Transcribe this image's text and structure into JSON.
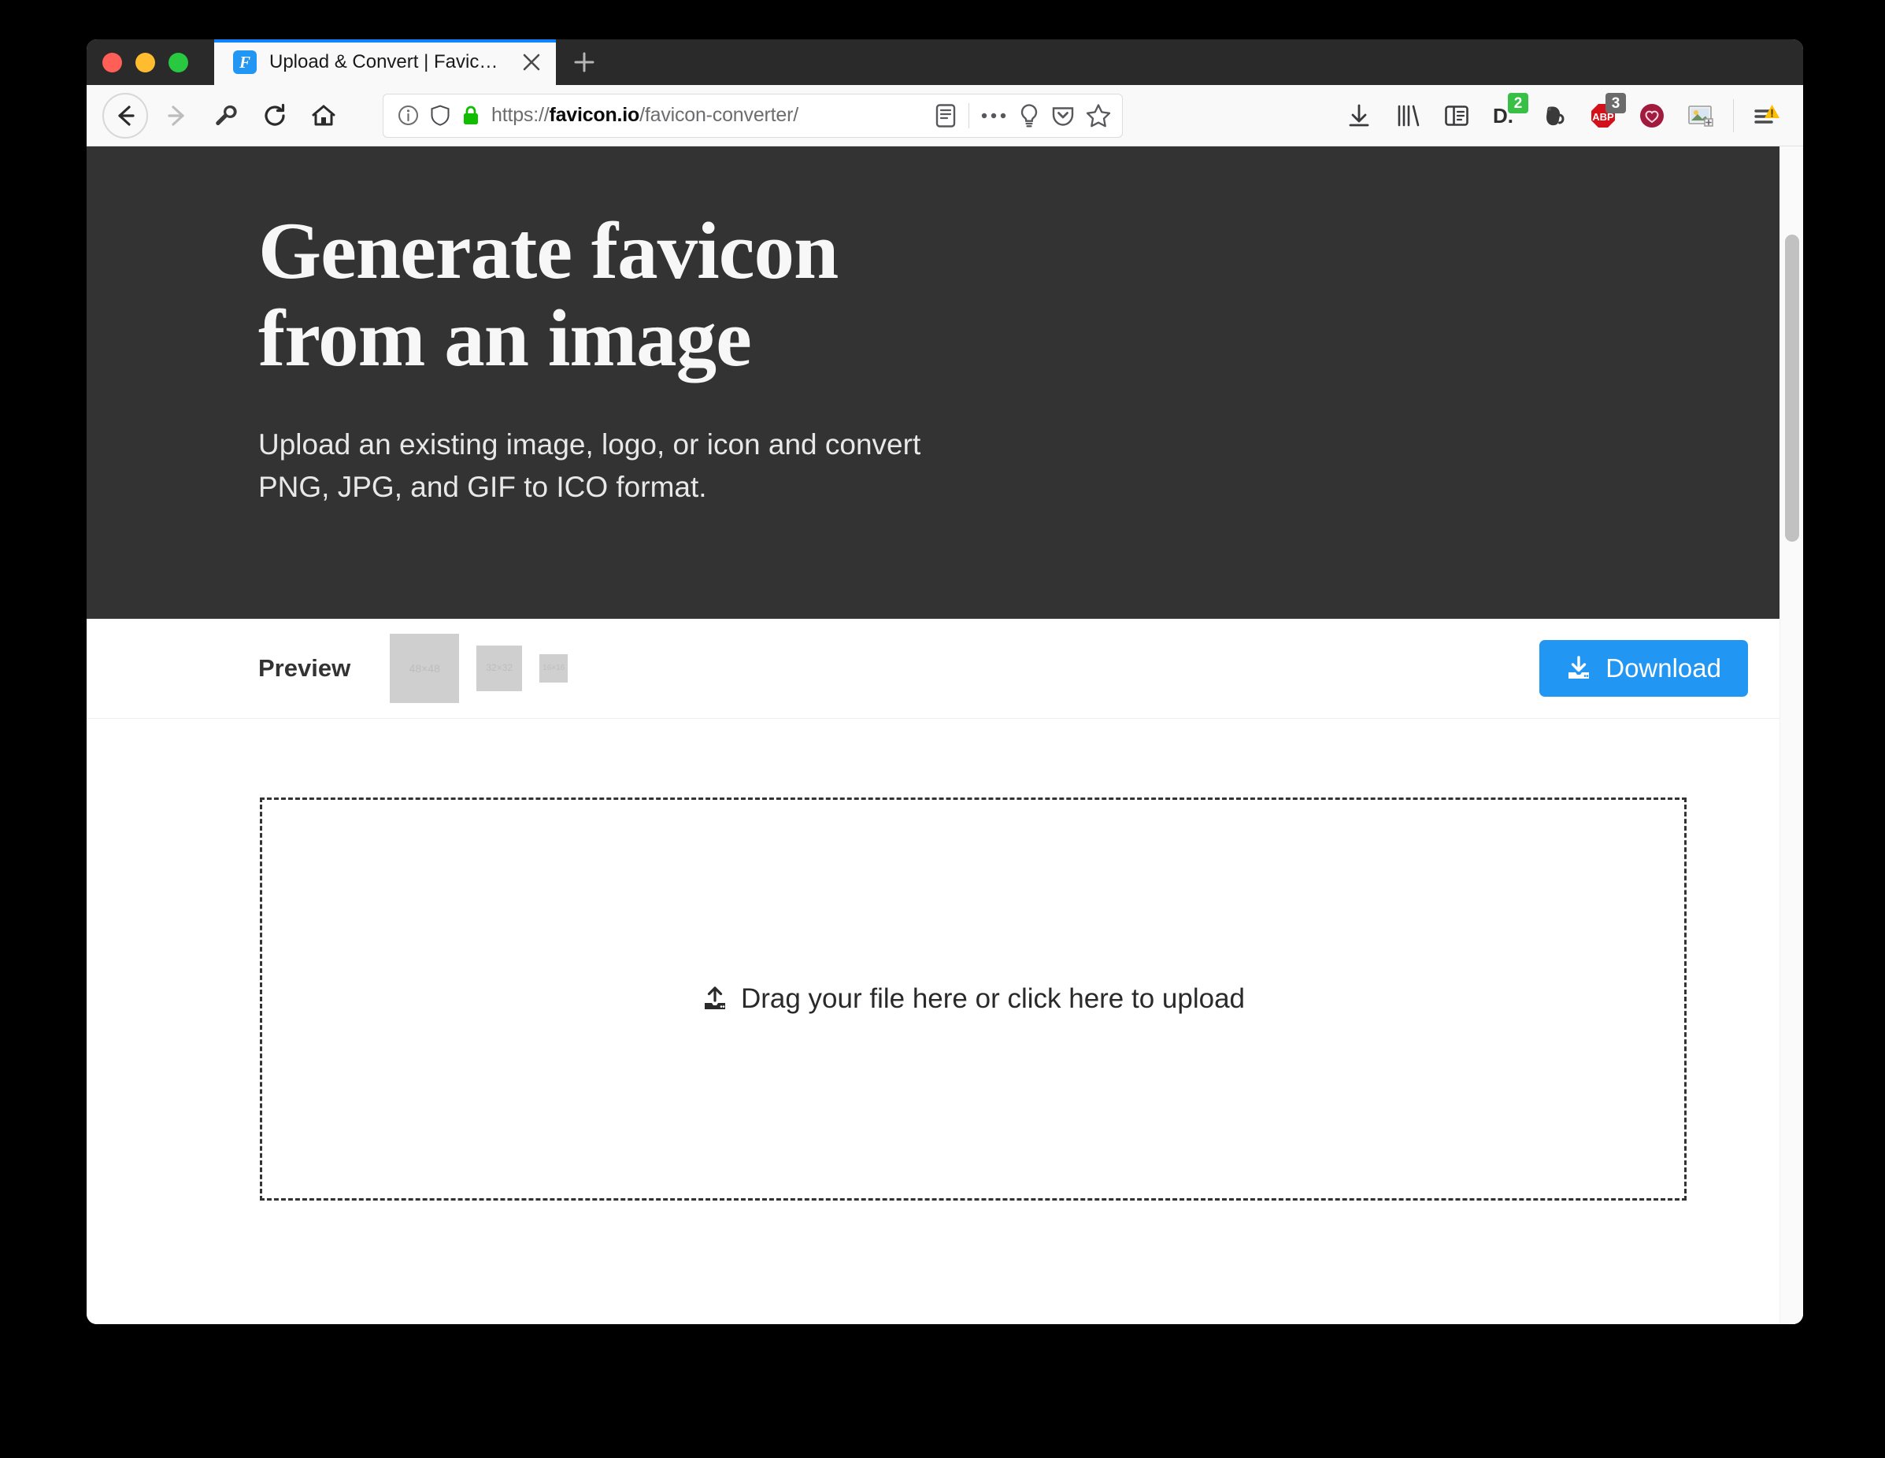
{
  "browser": {
    "traffic_lights": [
      "close",
      "minimize",
      "maximize"
    ],
    "tab": {
      "favicon_letter": "F",
      "title": "Upload & Convert | Favicon.io",
      "close_label": "×"
    },
    "new_tab_label": "+",
    "nav": {
      "back_icon": "back-arrow-icon",
      "forward_icon": "forward-arrow-icon",
      "tools_icon": "wrench-icon",
      "reload_icon": "reload-icon",
      "home_icon": "home-icon"
    },
    "url_bar": {
      "identity_icon": "info-circle-icon",
      "tracking_icon": "shield-icon",
      "lock_icon": "padlock-icon",
      "scheme": "https://",
      "host": "favicon.io",
      "path": "/favicon-converter/",
      "reader_icon": "reader-mode-icon",
      "page_actions_icon": "ellipsis-icon",
      "highlight_icon": "lightbulb-icon",
      "pocket_icon": "pocket-icon",
      "bookmark_icon": "star-icon"
    },
    "toolbar": [
      {
        "name": "downloads-icon",
        "badge": null,
        "badge_color": null
      },
      {
        "name": "library-icon",
        "badge": null,
        "badge_color": null
      },
      {
        "name": "sidebar-icon",
        "badge": null,
        "badge_color": null
      },
      {
        "name": "dashlane-icon",
        "badge": "2",
        "badge_color": "#37c045"
      },
      {
        "name": "evernote-icon",
        "badge": null,
        "badge_color": null
      },
      {
        "name": "adblockplus-icon",
        "badge": "3",
        "badge_color": "#6b6b6b"
      },
      {
        "name": "pocket-heart-icon",
        "badge": null,
        "badge_color": null
      },
      {
        "name": "screenshot-icon",
        "badge": null,
        "badge_color": null
      },
      {
        "name": "menu-icon",
        "badge": null,
        "badge_color": null
      }
    ],
    "adblock_label": "ABP",
    "dashlane_label": "D."
  },
  "hero": {
    "title": "Generate favicon\nfrom an image",
    "subtitle": "Upload an existing image, logo, or icon and convert\nPNG, JPG, and GIF to ICO format.",
    "background": "#333333"
  },
  "preview": {
    "label": "Preview",
    "thumbs": [
      {
        "size": "48×48",
        "name": "preview-thumb-48"
      },
      {
        "size": "32×32",
        "name": "preview-thumb-32"
      },
      {
        "size": "16×16",
        "name": "preview-thumb-16"
      }
    ],
    "download_label": "Download",
    "download_color": "#2196f3"
  },
  "dropzone": {
    "text": "Drag your file here or click here to upload",
    "icon": "upload-icon"
  },
  "scrollbar": {
    "thumb_color": "#c1c1c1"
  }
}
